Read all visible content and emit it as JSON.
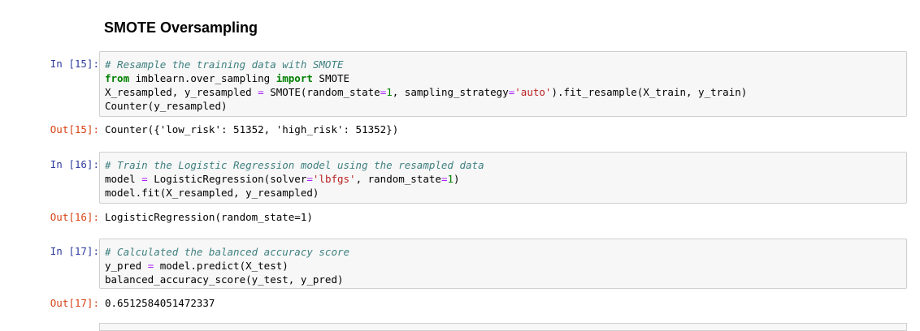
{
  "notebook": {
    "heading": "SMOTE Oversampling",
    "cells": [
      {
        "in_prompt": "In [15]:",
        "out_prompt": "Out[15]:",
        "output": "Counter({'low_risk': 51352, 'high_risk': 51352})",
        "lines": [
          [
            {
              "t": "# Resample the training data with SMOTE",
              "c": "cm"
            }
          ],
          [
            {
              "t": "from",
              "c": "kw"
            },
            {
              "t": " imblearn.over_sampling ",
              "c": ""
            },
            {
              "t": "import",
              "c": "kw"
            },
            {
              "t": " SMOTE",
              "c": ""
            }
          ],
          [
            {
              "t": "X_resampled, y_resampled ",
              "c": ""
            },
            {
              "t": "=",
              "c": "op"
            },
            {
              "t": " SMOTE(random_state",
              "c": ""
            },
            {
              "t": "=",
              "c": "op"
            },
            {
              "t": "1",
              "c": "num"
            },
            {
              "t": ", sampling_strategy",
              "c": ""
            },
            {
              "t": "=",
              "c": "op"
            },
            {
              "t": "'auto'",
              "c": "str"
            },
            {
              "t": ").fit_resample(X_train, y_train)",
              "c": ""
            }
          ],
          [
            {
              "t": "Counter(y_resampled)",
              "c": ""
            }
          ]
        ]
      },
      {
        "in_prompt": "In [16]:",
        "out_prompt": "Out[16]:",
        "output": "LogisticRegression(random_state=1)",
        "lines": [
          [
            {
              "t": "# Train the Logistic Regression model using the resampled data",
              "c": "cm"
            }
          ],
          [
            {
              "t": "model ",
              "c": ""
            },
            {
              "t": "=",
              "c": "op"
            },
            {
              "t": " LogisticRegression(solver",
              "c": ""
            },
            {
              "t": "=",
              "c": "op"
            },
            {
              "t": "'lbfgs'",
              "c": "str"
            },
            {
              "t": ", random_state",
              "c": ""
            },
            {
              "t": "=",
              "c": "op"
            },
            {
              "t": "1",
              "c": "num"
            },
            {
              "t": ")",
              "c": ""
            }
          ],
          [
            {
              "t": "model.fit(X_resampled, y_resampled)",
              "c": ""
            }
          ]
        ]
      },
      {
        "in_prompt": "In [17]:",
        "out_prompt": "Out[17]:",
        "output": "0.6512584051472337",
        "lines": [
          [
            {
              "t": "# Calculated the balanced accuracy score",
              "c": "cm"
            }
          ],
          [
            {
              "t": "y_pred ",
              "c": ""
            },
            {
              "t": "=",
              "c": "op"
            },
            {
              "t": " model.predict(X_test)",
              "c": ""
            }
          ],
          [
            {
              "t": "balanced_accuracy_score(y_test, y_pred)",
              "c": ""
            }
          ]
        ]
      }
    ]
  }
}
